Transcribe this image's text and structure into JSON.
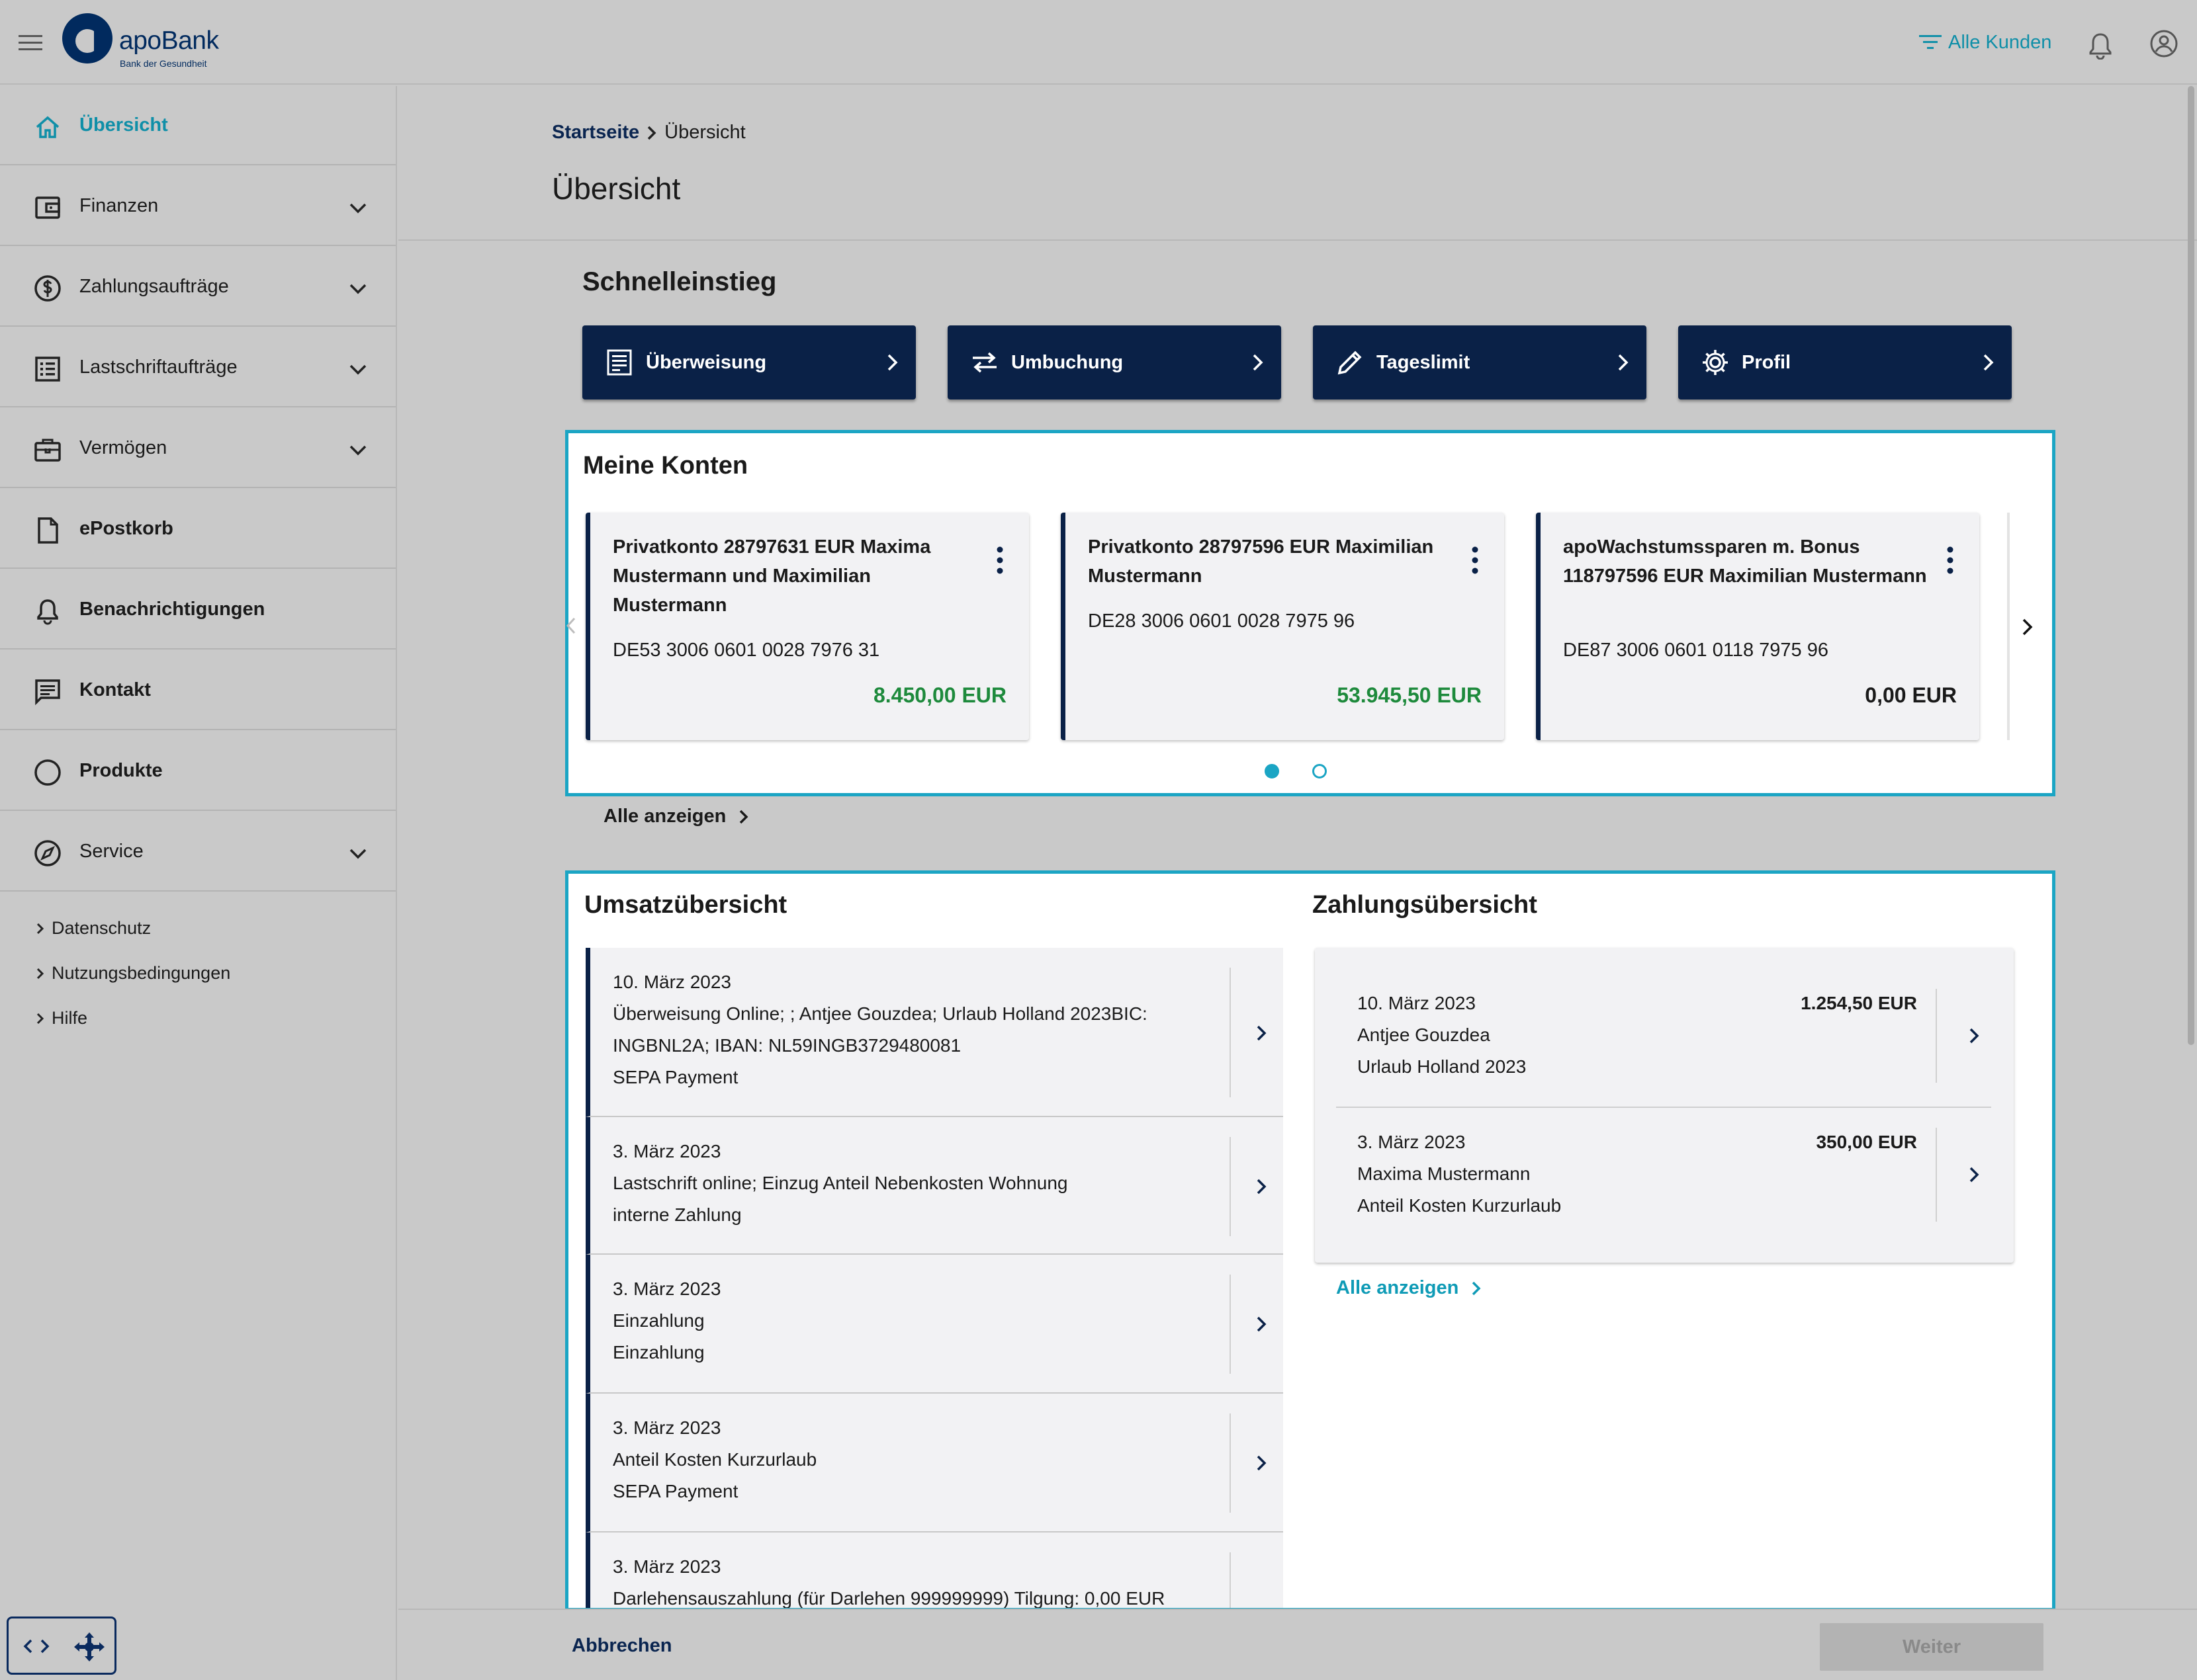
{
  "header": {
    "brand": "apoBank",
    "tagline": "Bank der Gesundheit",
    "filter_label": "Alle Kunden"
  },
  "colors": {
    "navy": "#0a2147",
    "teal": "#1ba5c4",
    "positive": "#1e8a3c"
  },
  "sidebar": {
    "items": [
      {
        "label": "Übersicht",
        "icon": "home-icon",
        "active": true
      },
      {
        "label": "Finanzen",
        "icon": "wallet-icon"
      },
      {
        "label": "Zahlungsaufträge",
        "icon": "dollar-circle-icon"
      },
      {
        "label": "Lastschriftaufträge",
        "icon": "list-icon"
      },
      {
        "label": "Vermögen",
        "icon": "briefcase-icon"
      },
      {
        "label": "ePostkorb",
        "icon": "document-icon"
      },
      {
        "label": "Benachrichtigungen",
        "icon": "bell-icon"
      },
      {
        "label": "Kontakt",
        "icon": "chat-icon"
      },
      {
        "label": "Produkte",
        "icon": "circle-icon"
      },
      {
        "label": "Service",
        "icon": "compass-icon"
      }
    ],
    "footer_links": [
      "Datenschutz",
      "Nutzungsbedingungen",
      "Hilfe"
    ]
  },
  "breadcrumb": {
    "home": "Startseite",
    "current": "Übersicht"
  },
  "page_title": "Übersicht",
  "quick_access": {
    "title": "Schnelleinstieg",
    "buttons": [
      {
        "label": "Überweisung",
        "icon": "transfer-form-icon"
      },
      {
        "label": "Umbuchung",
        "icon": "swap-icon"
      },
      {
        "label": "Tageslimit",
        "icon": "pencil-icon"
      },
      {
        "label": "Profil",
        "icon": "gear-icon"
      }
    ]
  },
  "accounts": {
    "title": "Meine Konten",
    "items": [
      {
        "name": "Privatkonto 28797631 EUR Maxima Mustermann und Maximilian Mustermann",
        "iban": "DE53 3006 0601 0028 7976 31",
        "balance": "8.450,00 EUR"
      },
      {
        "name": "Privatkonto 28797596 EUR Maximilian Mustermann",
        "iban": "DE28 3006 0601 0028 7975 96",
        "balance": "53.945,50 EUR"
      },
      {
        "name": "apoWachstumssparen m. Bonus 118797596 EUR Maximilian Mustermann",
        "iban": "DE87 3006 0601 0118 7975 96",
        "balance": "0,00 EUR"
      }
    ],
    "show_all": "Alle anzeigen"
  },
  "turnover": {
    "title": "Umsatzübersicht",
    "items": [
      {
        "date": "10. März 2023",
        "line1": "Überweisung Online; ; Antjee Gouzdea; Urlaub Holland 2023BIC:",
        "line2": "INGBNL2A; IBAN: NL59INGB3729480081",
        "line3": "SEPA Payment"
      },
      {
        "date": "3. März 2023",
        "line1": "Lastschrift online; Einzug Anteil Nebenkosten Wohnung",
        "line2": "interne Zahlung"
      },
      {
        "date": "3. März 2023",
        "line1": "Einzahlung",
        "line2": "Einzahlung"
      },
      {
        "date": "3. März 2023",
        "line1": "Anteil Kosten Kurzurlaub",
        "line2": "SEPA Payment"
      },
      {
        "date": "3. März 2023",
        "line1": "Darlehensauszahlung (für Darlehen 999999999) Tilgung: 0,00 EUR"
      }
    ]
  },
  "payments": {
    "title": "Zahlungsübersicht",
    "items": [
      {
        "date": "10. März 2023",
        "name": "Antjee Gouzdea",
        "purpose": "Urlaub Holland 2023",
        "amount": "1.254,50 EUR"
      },
      {
        "date": "3. März 2023",
        "name": "Maxima Mustermann",
        "purpose": "Anteil Kosten Kurzurlaub",
        "amount": "350,00 EUR"
      }
    ],
    "show_all": "Alle anzeigen"
  },
  "footer": {
    "cancel": "Abbrechen",
    "next": "Weiter"
  }
}
